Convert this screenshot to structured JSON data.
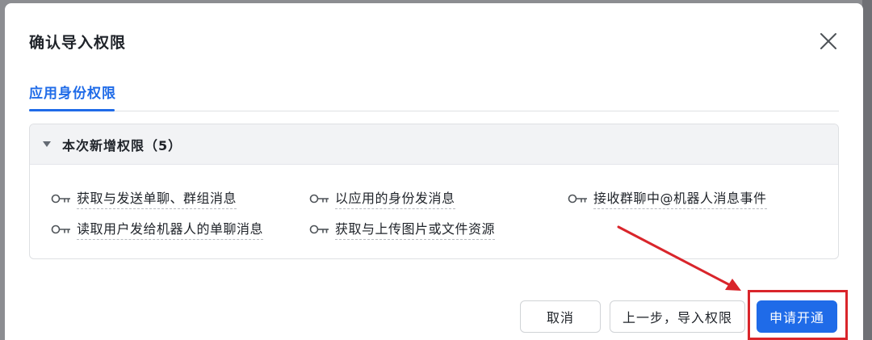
{
  "dialog": {
    "title": "确认导入权限",
    "close_icon": "close-icon"
  },
  "tabs": [
    {
      "label": "应用身份权限",
      "active": true
    }
  ],
  "panel": {
    "header": "本次新增权限（5）",
    "expanded": true,
    "permissions": [
      {
        "label": "获取与发送单聊、群组消息",
        "icon": "key-icon"
      },
      {
        "label": "以应用的身份发消息",
        "icon": "key-icon"
      },
      {
        "label": "接收群聊中@机器人消息事件",
        "icon": "key-icon"
      },
      {
        "label": "读取用户发给机器人的单聊消息",
        "icon": "key-icon"
      },
      {
        "label": "获取与上传图片或文件资源",
        "icon": "key-icon"
      }
    ]
  },
  "footer": {
    "cancel_label": "取消",
    "back_label": "上一步，导入权限",
    "submit_label": "申请开通"
  },
  "colors": {
    "accent": "#1f6be8",
    "annotation": "#d9252b"
  }
}
